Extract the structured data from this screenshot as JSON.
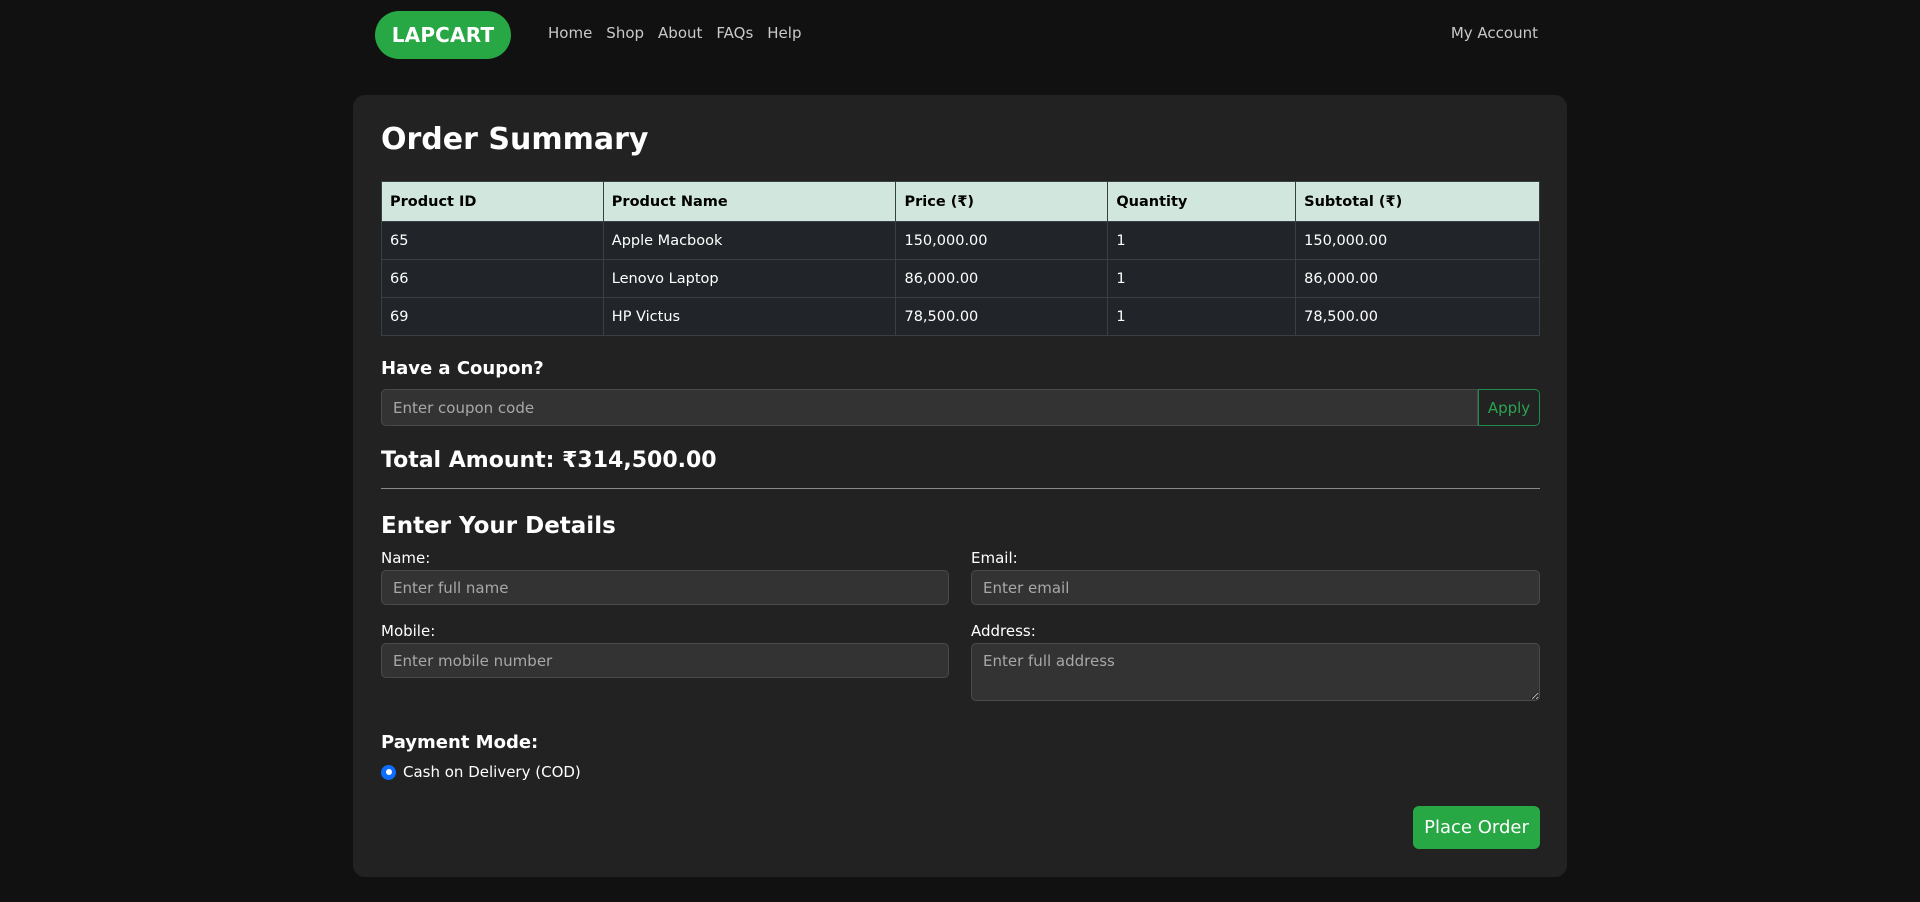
{
  "nav": {
    "brand": "LAPCART",
    "links": [
      "Home",
      "Shop",
      "About",
      "FAQs",
      "Help"
    ],
    "account": "My Account"
  },
  "page": {
    "title": "Order Summary"
  },
  "table": {
    "headers": [
      "Product ID",
      "Product Name",
      "Price (₹)",
      "Quantity",
      "Subtotal (₹)"
    ],
    "rows": [
      [
        "65",
        "Apple Macbook",
        "150,000.00",
        "1",
        "150,000.00"
      ],
      [
        "66",
        "Lenovo Laptop",
        "86,000.00",
        "1",
        "86,000.00"
      ],
      [
        "69",
        "HP Victus",
        "78,500.00",
        "1",
        "78,500.00"
      ]
    ]
  },
  "coupon": {
    "heading": "Have a Coupon?",
    "placeholder": "Enter coupon code",
    "value": "",
    "apply_label": "Apply"
  },
  "total": {
    "text": "Total Amount: ₹314,500.00"
  },
  "details": {
    "heading": "Enter Your Details",
    "name_label": "Name:",
    "name_placeholder": "Enter full name",
    "email_label": "Email:",
    "email_placeholder": "Enter email",
    "mobile_label": "Mobile:",
    "mobile_placeholder": "Enter mobile number",
    "address_label": "Address:",
    "address_placeholder": "Enter full address"
  },
  "payment": {
    "heading": "Payment Mode:",
    "option": "Cash on Delivery (COD)",
    "selected": true
  },
  "actions": {
    "place_order": "Place Order"
  },
  "colors": {
    "accent": "#28a745",
    "table_header": "#d1e7dd",
    "radio": "#0d6efd"
  }
}
